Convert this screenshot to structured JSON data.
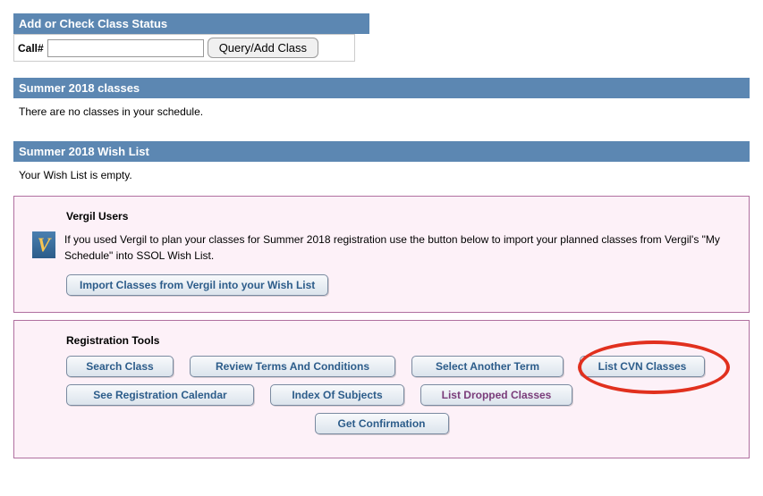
{
  "add_check": {
    "header": "Add or Check Class Status",
    "call_label": "Call#",
    "call_value": "",
    "query_button": "Query/Add Class"
  },
  "classes": {
    "header": "Summer 2018 classes",
    "empty_text": "There are no classes in your schedule."
  },
  "wishlist": {
    "header": "Summer 2018 Wish List",
    "empty_text": "Your Wish List is empty."
  },
  "vergil": {
    "heading": "Vergil Users",
    "icon_letter": "V",
    "description": "If you used Vergil to plan your classes for Summer 2018 registration use the button below to import your planned classes from Vergil's \"My Schedule\" into SSOL Wish List.",
    "import_button": "Import Classes from Vergil into your Wish List"
  },
  "tools": {
    "heading": "Registration Tools",
    "search_class": "Search Class",
    "review_terms": "Review Terms And Conditions",
    "select_term": "Select Another Term",
    "list_cvn": "List CVN Classes",
    "see_calendar": "See Registration Calendar",
    "index_subjects": "Index Of Subjects",
    "list_dropped": "List Dropped Classes",
    "get_confirmation": "Get Confirmation"
  }
}
